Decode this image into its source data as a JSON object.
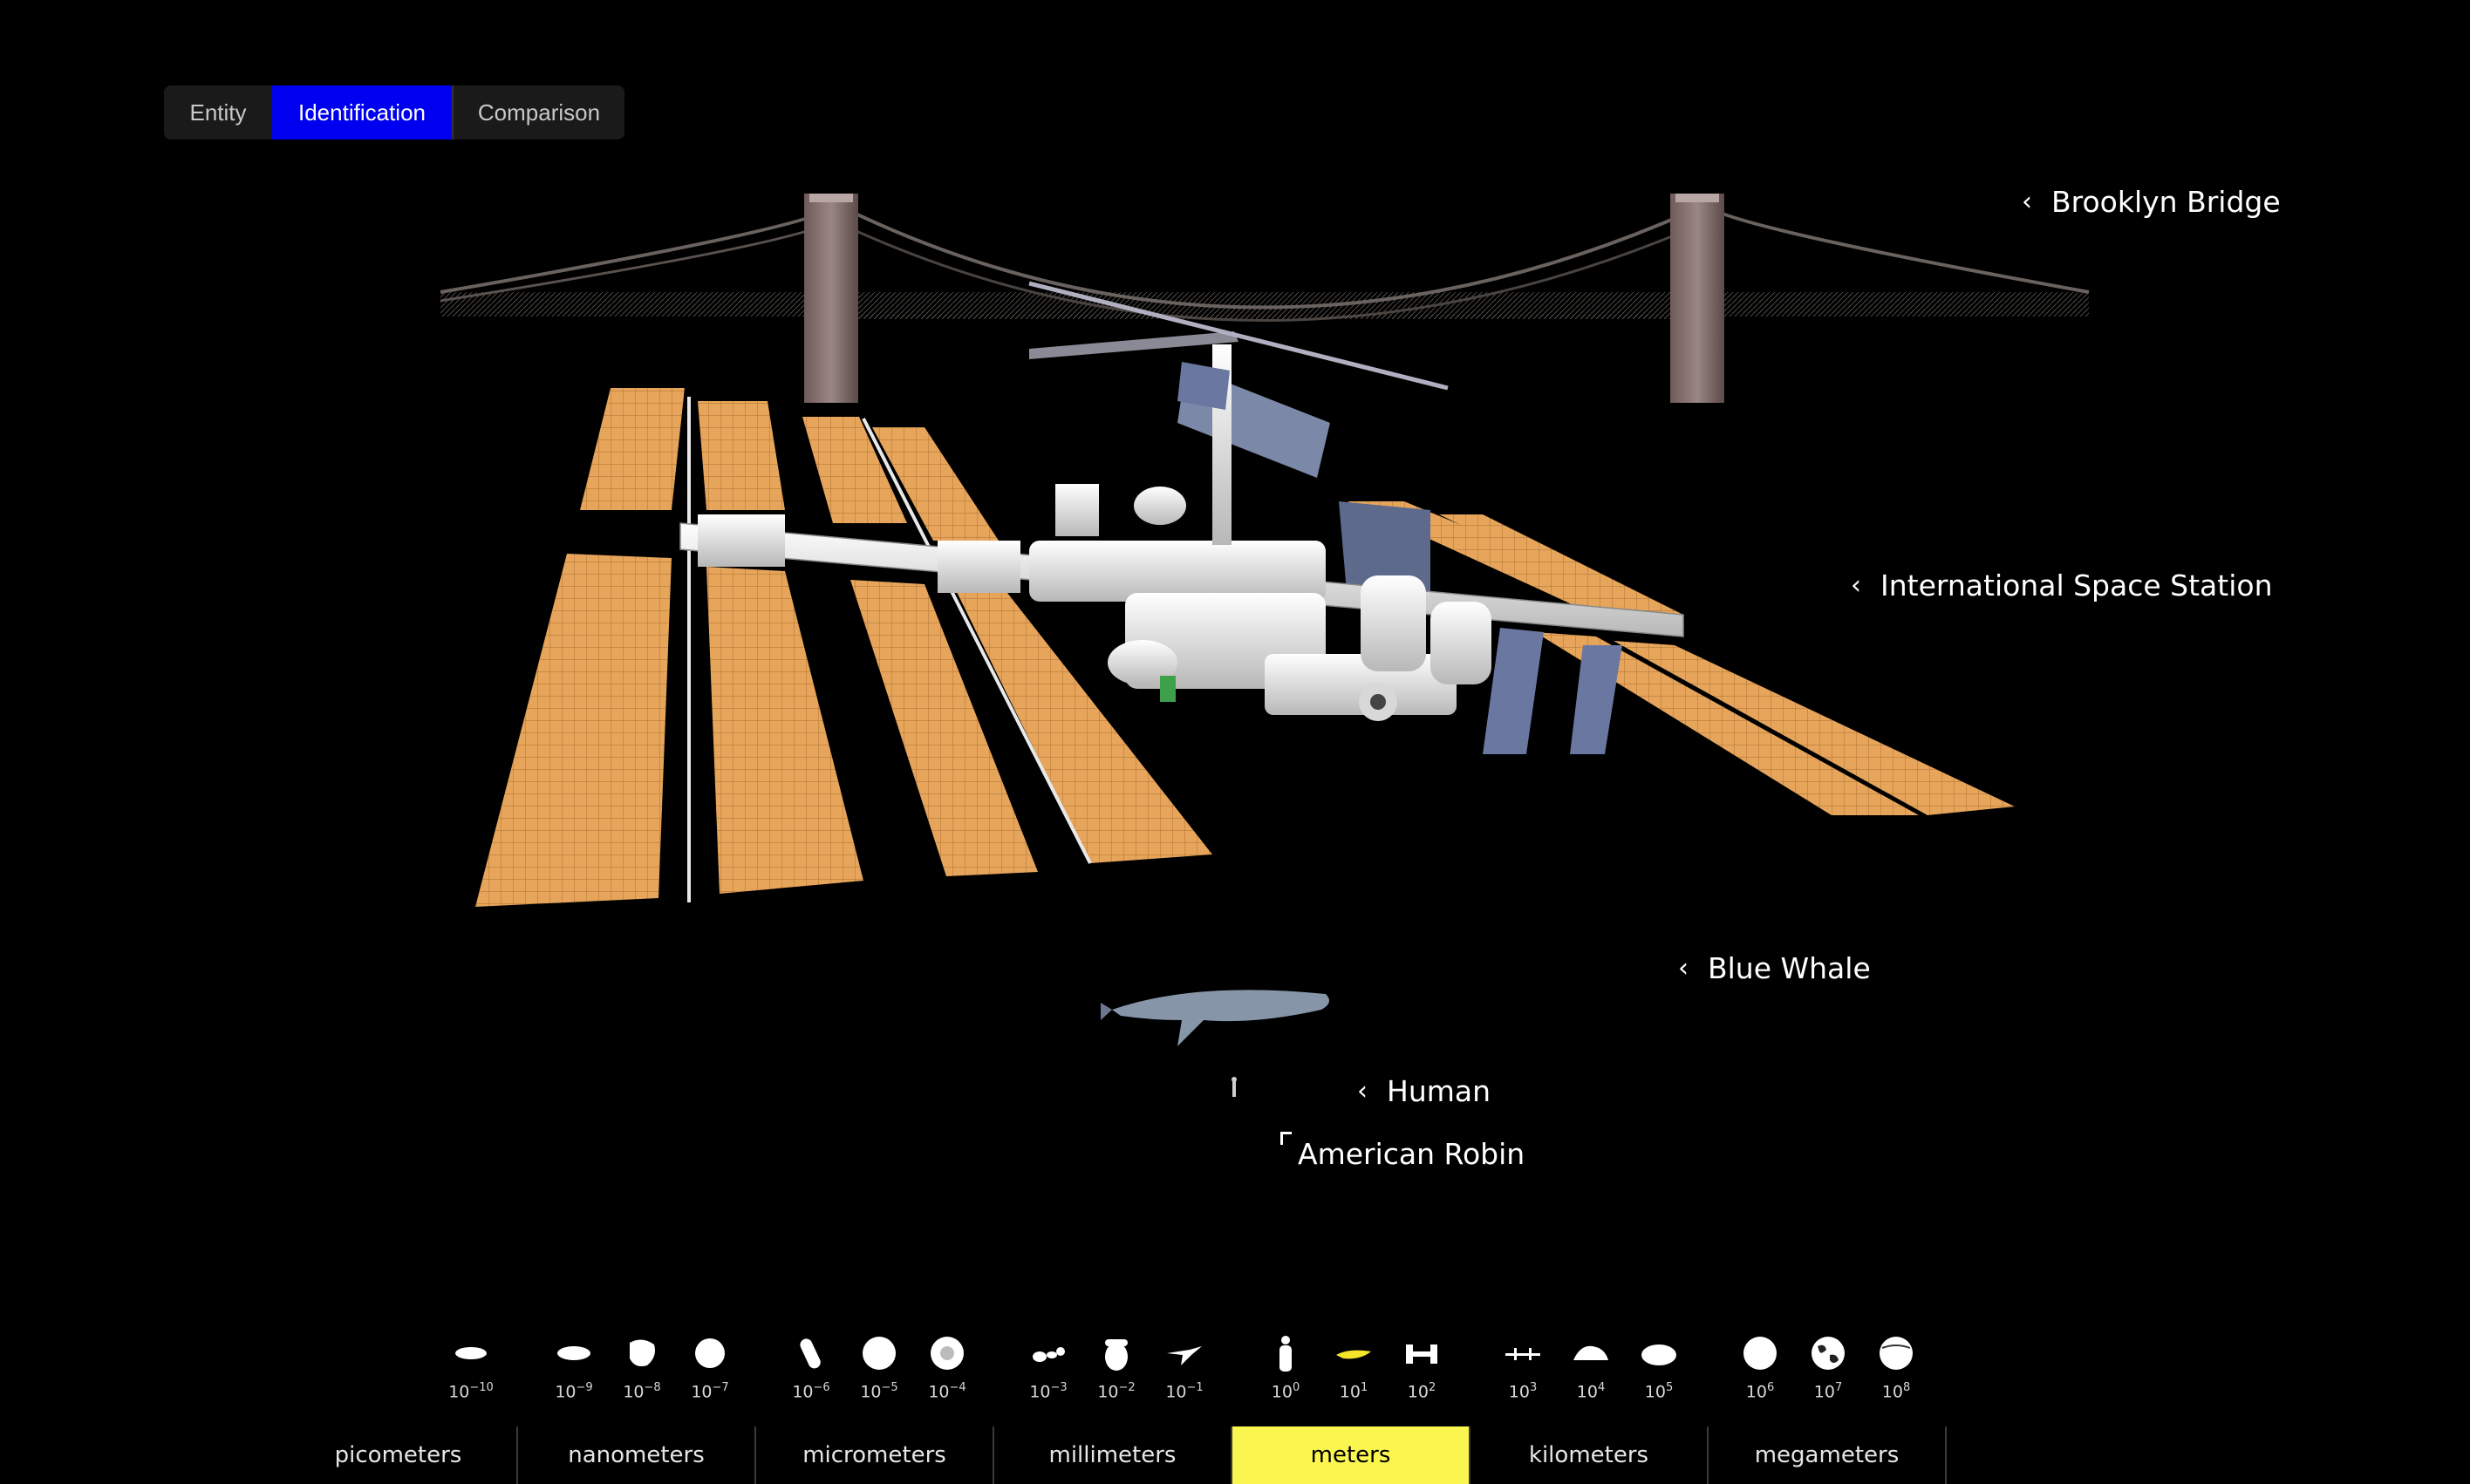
{
  "view_modes": {
    "items": [
      {
        "label": "Entity",
        "active": false
      },
      {
        "label": "Identification",
        "active": true
      },
      {
        "label": "Comparison",
        "active": false
      }
    ]
  },
  "labels": {
    "brooklyn_bridge": "Brooklyn Bridge",
    "iss": "International Space Station",
    "blue_whale": "Blue Whale",
    "human": "Human",
    "american_robin": "American Robin"
  },
  "scale": {
    "magnitudes": [
      {
        "base": "10",
        "exp": "−10",
        "icon": "virus-icon"
      },
      {
        "base": "10",
        "exp": "−9",
        "icon": "molecule-icon"
      },
      {
        "base": "10",
        "exp": "−8",
        "icon": "protein-icon"
      },
      {
        "base": "10",
        "exp": "−7",
        "icon": "coronavirus-icon"
      },
      {
        "base": "10",
        "exp": "−6",
        "icon": "bacterium-icon"
      },
      {
        "base": "10",
        "exp": "−5",
        "icon": "cell-icon"
      },
      {
        "base": "10",
        "exp": "−4",
        "icon": "amoeba-icon"
      },
      {
        "base": "10",
        "exp": "−3",
        "icon": "ant-icon"
      },
      {
        "base": "10",
        "exp": "−2",
        "icon": "acorn-icon"
      },
      {
        "base": "10",
        "exp": "−1",
        "icon": "hummingbird-icon"
      },
      {
        "base": "10",
        "exp": "0",
        "icon": "human-icon"
      },
      {
        "base": "10",
        "exp": "1",
        "icon": "whale-icon"
      },
      {
        "base": "10",
        "exp": "2",
        "icon": "space-station-icon"
      },
      {
        "base": "10",
        "exp": "3",
        "icon": "bridge-icon"
      },
      {
        "base": "10",
        "exp": "4",
        "icon": "island-icon"
      },
      {
        "base": "10",
        "exp": "5",
        "icon": "lake-icon"
      },
      {
        "base": "10",
        "exp": "6",
        "icon": "moon-icon"
      },
      {
        "base": "10",
        "exp": "7",
        "icon": "earth-icon"
      },
      {
        "base": "10",
        "exp": "8",
        "icon": "jupiter-icon"
      }
    ],
    "active_magnitude": "1",
    "units": [
      {
        "label": "picometers",
        "active": false
      },
      {
        "label": "nanometers",
        "active": false
      },
      {
        "label": "micrometers",
        "active": false
      },
      {
        "label": "millimeters",
        "active": false
      },
      {
        "label": "meters",
        "active": true
      },
      {
        "label": "kilometers",
        "active": false
      },
      {
        "label": "megameters",
        "active": false
      }
    ]
  },
  "colors": {
    "active_mode": "#0000f0",
    "active_unit": "#fbf550",
    "active_icon": "#f5e52a",
    "solar_panel": "#e6a55a"
  }
}
